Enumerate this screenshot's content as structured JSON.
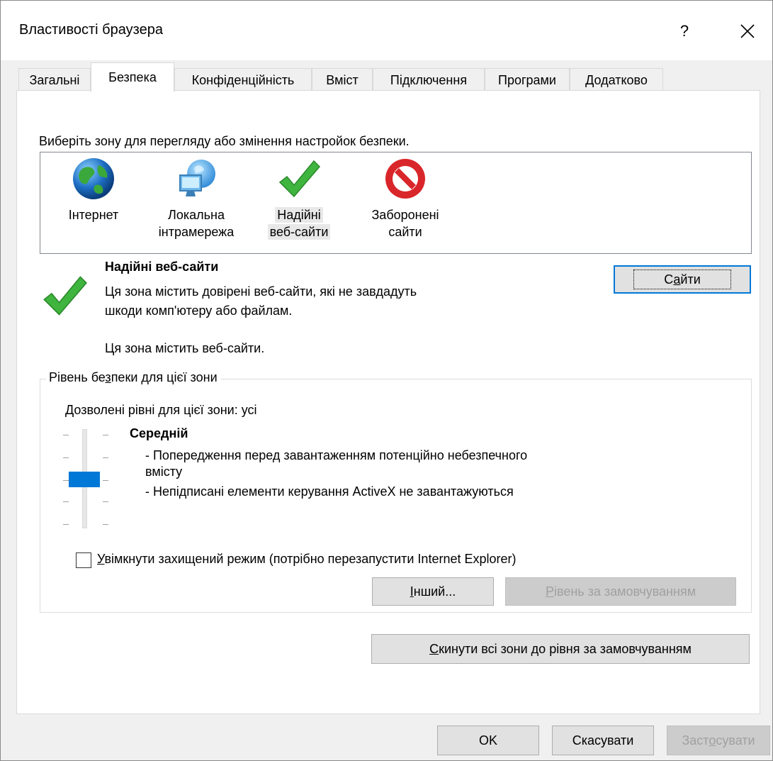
{
  "window": {
    "title": "Властивості браузера",
    "help_label": "?"
  },
  "tabs": [
    {
      "label": "Загальні"
    },
    {
      "label": "Безпека"
    },
    {
      "label": "Конфіденційність"
    },
    {
      "label": "Вміст"
    },
    {
      "label": "Підключення"
    },
    {
      "label": "Програми"
    },
    {
      "label": "Додатково"
    }
  ],
  "security": {
    "zone_prompt": "Виберіть зону для перегляду або змінення настройок безпеки.",
    "zones": [
      {
        "line1": "Інтернет",
        "line2": "",
        "icon": "globe-icon"
      },
      {
        "line1": "Локальна",
        "line2": "інтрамережа",
        "icon": "intranet-icon"
      },
      {
        "line1": "Надійні",
        "line2": "веб-сайти",
        "icon": "checkmark-icon"
      },
      {
        "line1": "Заборонені",
        "line2": "сайти",
        "icon": "prohibited-icon"
      }
    ],
    "selected_zone": {
      "title": "Надійні веб-сайти",
      "desc_line1": "Ця зона містить довірені веб-сайти, які не завдадуть",
      "desc_line2": "шкоди комп'ютеру або файлам.",
      "note": "Ця зона містить веб-сайти."
    },
    "sites_button": {
      "pre": "С",
      "accel": "а",
      "post": "йти"
    },
    "level_group": {
      "title_pre": "Рівень бе",
      "title_accel": "з",
      "title_post": "пеки для цієї зони",
      "allowed": "Дозволені рівні для цієї зони: усі",
      "level_name": "Середній",
      "bullet1_line1": "- Попередження перед завантаженням потенційно небезпечного",
      "bullet1_line2": "вмісту",
      "bullet2": "- Непідписані елементи керування ActiveX не завантажуються",
      "slider_level": 0.5,
      "protected_mode_accel": "У",
      "protected_mode_rest": "вімкнути захищений режим (потрібно перезапустити Internet Explorer)",
      "protected_mode_checked": false,
      "custom_button": {
        "accel": "І",
        "rest": "нший..."
      },
      "default_button": {
        "accel": "Р",
        "rest": "івень за замовчуванням"
      }
    },
    "reset_all_button": {
      "accel": "С",
      "rest": "кинути всі зони до рівня за замовчуванням"
    }
  },
  "footer": {
    "ok": "OK",
    "cancel": "Скасувати",
    "apply_pre": "Заст",
    "apply_accel": "о",
    "apply_post": "сувати"
  },
  "colors": {
    "accent": "#0078d7",
    "check_green": "#3fb43f",
    "prohibited_red": "#d9262a"
  }
}
